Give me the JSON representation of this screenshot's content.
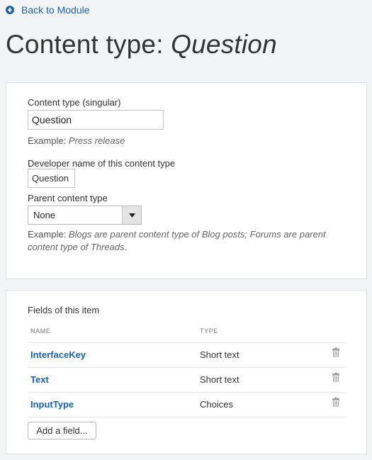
{
  "nav": {
    "back_label": "Back to Module"
  },
  "header": {
    "title_prefix": "Content type: ",
    "title_name": "Question"
  },
  "form": {
    "singular_label": "Content type (singular)",
    "singular_value": "Question",
    "singular_example_key": "Example:",
    "singular_example_value": "Press release",
    "developer_label": "Developer name of this content type",
    "developer_value": "Question",
    "parent_label": "Parent content type",
    "parent_selected": "None",
    "parent_example_key": "Example:",
    "parent_example_value": "Blogs are parent content type of Blog posts; Forums are parent content type of Threads."
  },
  "fields": {
    "title": "Fields of this item",
    "columns": [
      "NAME",
      "TYPE"
    ],
    "rows": [
      {
        "name": "InterfaceKey",
        "type": "Short text"
      },
      {
        "name": "Text",
        "type": "Short text"
      },
      {
        "name": "InputType",
        "type": "Choices"
      }
    ],
    "add_label": "Add a field..."
  },
  "icons": {
    "back": "arrow-circle-left-icon",
    "select": "caret-down-icon",
    "delete": "trash-icon"
  },
  "colors": {
    "link": "#1b63a8",
    "background": "#f3f4f6"
  }
}
